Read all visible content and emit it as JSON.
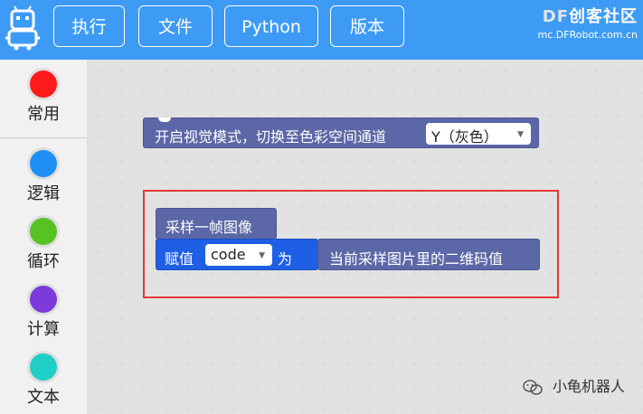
{
  "toolbar": {
    "buttons": [
      "执行",
      "文件",
      "Python",
      "版本"
    ]
  },
  "brand": {
    "title_prefix": "DF",
    "title_suffix": "创客社区",
    "url": "mc.DFRobot.com.cn"
  },
  "sidebar": {
    "categories": [
      {
        "label": "常用",
        "color": "#ff1a1a"
      },
      {
        "label": "逻辑",
        "color": "#1f8ff5"
      },
      {
        "label": "循环",
        "color": "#57c223"
      },
      {
        "label": "计算",
        "color": "#7b3ad9"
      },
      {
        "label": "文本",
        "color": "#1fcfc8"
      }
    ]
  },
  "blocks": {
    "vision": {
      "text": "开启视觉模式，切换至色彩空间通道",
      "dropdown_value": "Y（灰色）"
    },
    "sample": {
      "text": "采样一帧图像"
    },
    "assign": {
      "prefix": "赋值",
      "variable": "code",
      "suffix": "为"
    },
    "qr": {
      "text": "当前采样图片里的二维码值"
    }
  },
  "watermark": {
    "text": "小龟机器人"
  }
}
